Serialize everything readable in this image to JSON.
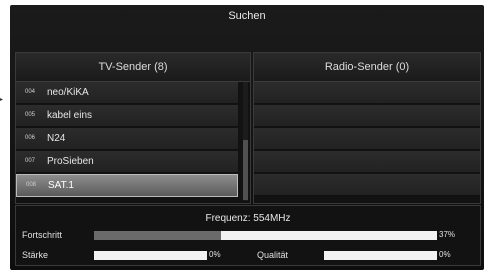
{
  "title": "Suchen",
  "tv_panel": {
    "header": "TV-Sender (8)",
    "channels": [
      {
        "num": "004",
        "name": "neo/KiKA"
      },
      {
        "num": "005",
        "name": "kabel eins"
      },
      {
        "num": "006",
        "name": "N24"
      },
      {
        "num": "007",
        "name": "ProSieben"
      },
      {
        "num": "008",
        "name": "SAT.1"
      }
    ],
    "selected_index": 4
  },
  "radio_panel": {
    "header": "Radio-Sender (0)"
  },
  "info": {
    "frequency": "Frequenz: 554MHz",
    "progress_label": "Fortschritt",
    "progress_value": "37%",
    "progress_fraction": 0.37,
    "strength_label": "Stärke",
    "strength_value": "0%",
    "strength_fraction": 0,
    "quality_label": "Qualität",
    "quality_value": "0%",
    "quality_fraction": 0
  }
}
